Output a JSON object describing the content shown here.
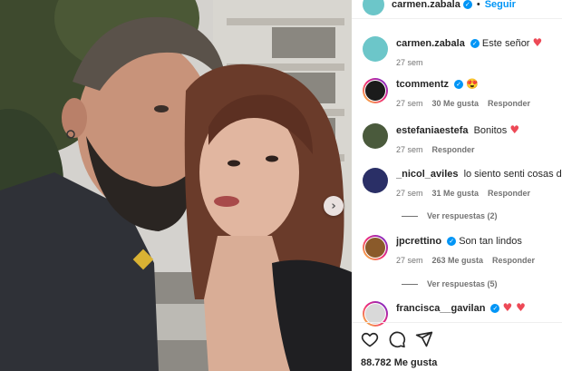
{
  "post": {
    "author": "carmen.zabala",
    "follow_label": "Seguir",
    "separator": "•",
    "likes_text": "88.782 Me gusta"
  },
  "comments": [
    {
      "username": "carmen.zabala",
      "text": "Este señor",
      "emoji": "♥",
      "time": "27 sem",
      "likes": "",
      "reply": "",
      "verified": true,
      "avatar_color": "#6cc6c9"
    },
    {
      "username": "tcommentz",
      "text": "",
      "emoji": "😍",
      "time": "27 sem",
      "likes": "30 Me gusta",
      "reply": "Responder",
      "verified": true,
      "avatar_color": "#1b1b1b"
    },
    {
      "username": "estefaniaestefa",
      "text": "Bonitos",
      "emoji": "♥",
      "time": "27 sem",
      "likes": "",
      "reply": "Responder",
      "verified": false,
      "avatar_color": "#4a5a3c"
    },
    {
      "username": "_nicol_aviles",
      "text": "lo siento senti cosas del nio",
      "emoji": "",
      "time": "27 sem",
      "likes": "31 Me gusta",
      "reply": "Responder",
      "verified": false,
      "avatar_color": "#2a2f66"
    },
    {
      "username": "jpcrettino",
      "text": "Son tan lindos",
      "emoji": "",
      "time": "27 sem",
      "likes": "263 Me gusta",
      "reply": "Responder",
      "verified": true,
      "avatar_color": "#8a5a2a"
    },
    {
      "username": "francisca__gavilan",
      "text": "",
      "emoji": "♥ ♥",
      "time": "",
      "likes": "",
      "reply": "",
      "verified": true,
      "avatar_color": "#d9d9d9"
    }
  ],
  "view_replies": [
    {
      "label": "Ver respuestas (2)"
    },
    {
      "label": "Ver respuestas (5)"
    }
  ],
  "icons": [
    "heart-icon",
    "comment-icon",
    "share-icon",
    "verified-badge-icon",
    "chevron-right-icon"
  ],
  "colors": {
    "accent": "#0095f6",
    "heart": "#ed4956",
    "text": "#262626",
    "muted": "#737373"
  }
}
